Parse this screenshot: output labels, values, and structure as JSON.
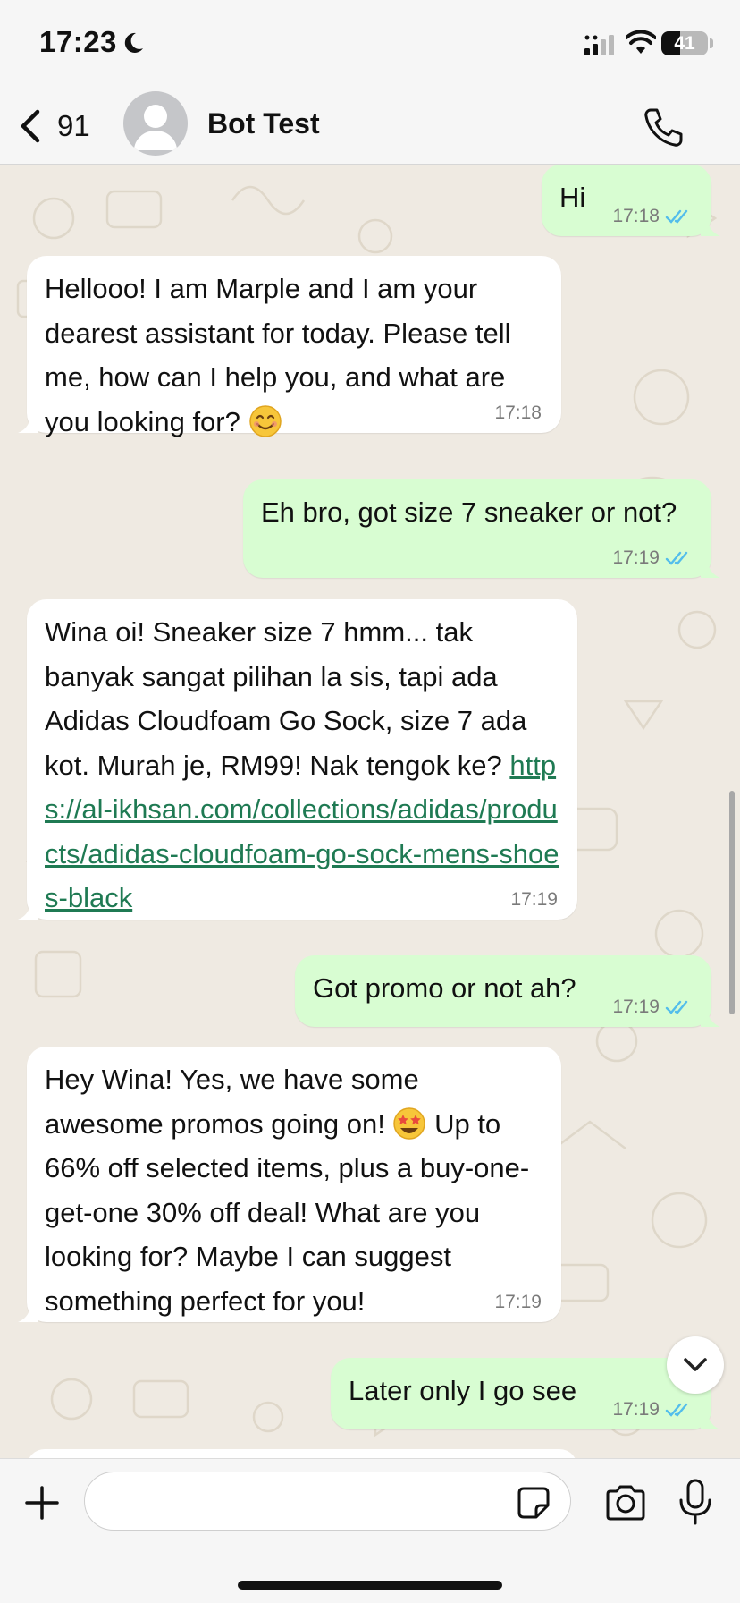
{
  "status_bar": {
    "time": "17:23",
    "battery_level": "41",
    "battery_fraction": 0.41,
    "icons": [
      "moon-icon",
      "cellular-signal-icon",
      "wifi-icon",
      "battery-icon"
    ]
  },
  "header": {
    "back_count": "91",
    "contact_name": "Bot Test",
    "icons": [
      "back-chevron-icon",
      "avatar-placeholder-icon",
      "phone-call-icon"
    ]
  },
  "messages": [
    {
      "direction": "out",
      "text": "Hi",
      "time": "17:18",
      "read": true
    },
    {
      "direction": "in",
      "text": "Hellooo! I am Marple and I am your dearest assistant for today. Please tell me, how can I help you, and what are you looking for?",
      "emoji": "smiling-face-emoji",
      "time": "17:18"
    },
    {
      "direction": "out",
      "text": "Eh bro, got size 7 sneaker or not?",
      "time": "17:19",
      "read": true
    },
    {
      "direction": "in",
      "text": "Wina oi!  Sneaker size 7 hmm... tak banyak sangat pilihan la sis, tapi ada Adidas Cloudfoam Go Sock, size 7 ada kot.  Murah je, RM99!  Nak tengok ke?",
      "link": "https://al-ikhsan.com/collections/adidas/products/adidas-cloudfoam-go-sock-mens-shoes-black",
      "time": "17:19"
    },
    {
      "direction": "out",
      "text": "Got promo or not ah?",
      "time": "17:19",
      "read": true
    },
    {
      "direction": "in",
      "text_before_emoji": "Hey Wina!  Yes, we have some awesome promos going on!",
      "emoji": "star-struck-emoji",
      "text_after_emoji": "Up to 66% off selected items, plus a buy-one-get-one 30% off deal!  What are you looking for?  Maybe I can suggest something perfect for you!",
      "time": "17:19"
    },
    {
      "direction": "out",
      "text": "Later only I go see",
      "time": "17:19",
      "read": true
    }
  ],
  "input_bar": {
    "placeholder": "",
    "value": "",
    "icons": [
      "plus-icon",
      "sticker-icon",
      "camera-icon",
      "microphone-icon"
    ]
  },
  "colors": {
    "outgoing_bubble": "#d8fdd2",
    "incoming_bubble": "#ffffff",
    "chat_background": "#efeae2",
    "link": "#1f7a53",
    "read_tick": "#53bdeb"
  }
}
